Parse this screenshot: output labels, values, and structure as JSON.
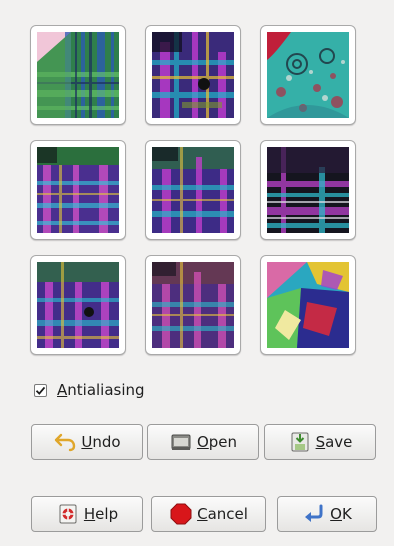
{
  "options": {
    "antialiasing": {
      "label_underlined": "A",
      "label_rest": "ntialiasing",
      "checked": true
    }
  },
  "tiles": [
    {
      "index": 1,
      "selected": false
    },
    {
      "index": 2,
      "selected": false
    },
    {
      "index": 3,
      "selected": false
    },
    {
      "index": 4,
      "selected": false
    },
    {
      "index": 5,
      "selected": false
    },
    {
      "index": 6,
      "selected": false
    },
    {
      "index": 7,
      "selected": false
    },
    {
      "index": 8,
      "selected": false
    },
    {
      "index": 9,
      "selected": false
    }
  ],
  "actions": {
    "undo": {
      "u": "U",
      "rest": "ndo",
      "icon": "undo-arrow-icon"
    },
    "open": {
      "u": "O",
      "rest": "pen",
      "icon": "open-folder-icon"
    },
    "save": {
      "u": "S",
      "rest": "ave",
      "icon": "save-disk-icon"
    }
  },
  "dialog_buttons": {
    "help": {
      "u": "H",
      "rest": "elp",
      "icon": "help-lifebuoy-icon"
    },
    "cancel": {
      "u": "C",
      "rest": "ancel",
      "icon": "stop-icon"
    },
    "ok": {
      "u": "O",
      "rest": "K",
      "icon": "return-arrow-icon"
    }
  },
  "colors": {
    "window_bg": "#f2f1f0",
    "tile_border": "#a9a9a9",
    "cancel_red": "#d8161a"
  }
}
